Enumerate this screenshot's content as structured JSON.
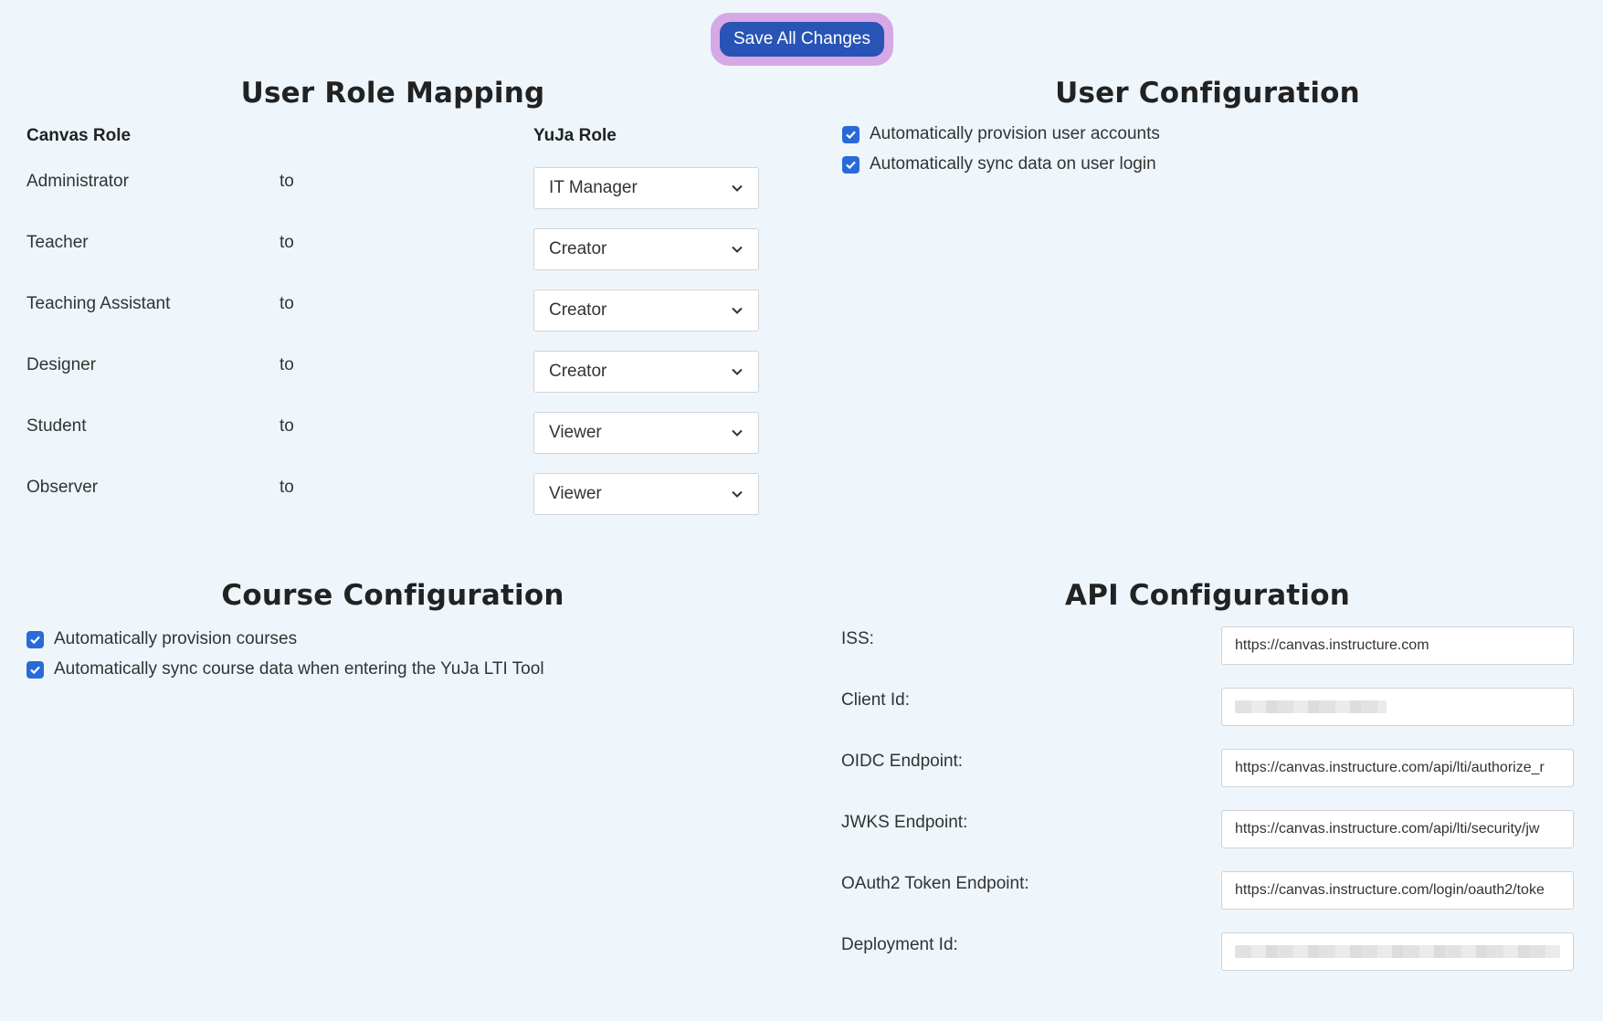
{
  "toolbar": {
    "save_label": "Save All Changes"
  },
  "role_mapping": {
    "title": "User Role Mapping",
    "canvas_header": "Canvas Role",
    "yuja_header": "YuJa Role",
    "connector": "to",
    "rows": [
      {
        "canvas_role": "Administrator",
        "yuja_role": "IT Manager"
      },
      {
        "canvas_role": "Teacher",
        "yuja_role": "Creator"
      },
      {
        "canvas_role": "Teaching Assistant",
        "yuja_role": "Creator"
      },
      {
        "canvas_role": "Designer",
        "yuja_role": "Creator"
      },
      {
        "canvas_role": "Student",
        "yuja_role": "Viewer"
      },
      {
        "canvas_role": "Observer",
        "yuja_role": "Viewer"
      }
    ]
  },
  "user_config": {
    "title": "User Configuration",
    "options": [
      {
        "label": "Automatically provision user accounts",
        "checked": true
      },
      {
        "label": "Automatically sync data on user login",
        "checked": true
      }
    ]
  },
  "course_config": {
    "title": "Course Configuration",
    "options": [
      {
        "label": "Automatically provision courses",
        "checked": true
      },
      {
        "label": "Automatically sync course data when entering the YuJa LTI Tool",
        "checked": true
      }
    ]
  },
  "api_config": {
    "title": "API Configuration",
    "fields": [
      {
        "label": "ISS:",
        "value": "https://canvas.instructure.com"
      },
      {
        "label": "Client Id:",
        "value": ""
      },
      {
        "label": "OIDC Endpoint:",
        "value": "https://canvas.instructure.com/api/lti/authorize_r"
      },
      {
        "label": "JWKS Endpoint:",
        "value": "https://canvas.instructure.com/api/lti/security/jw"
      },
      {
        "label": "OAuth2 Token Endpoint:",
        "value": "https://canvas.instructure.com/login/oauth2/toke"
      },
      {
        "label": "Deployment Id:",
        "value": ""
      }
    ]
  },
  "colors": {
    "background": "#eef6fc",
    "primary_button": "#2754b5",
    "button_focus_ring": "#d6a8e6",
    "checkbox": "#2a6ad8"
  }
}
